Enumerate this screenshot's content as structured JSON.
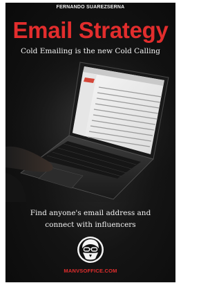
{
  "cover": {
    "author": "FERNANDO SUAREZSERNA",
    "title": "Email Strategy",
    "subtitle": "Cold Emailing is the new Cold Calling",
    "tagline_line1": "Find anyone's email address and",
    "tagline_line2": "connect with influencers",
    "brand": "MANVSOFFICE.COM",
    "title_color": "#e22d2d",
    "brand_color": "#e22d2d",
    "photo_icon": "laptop-icon",
    "logo_icon": "masked-face-logo"
  }
}
